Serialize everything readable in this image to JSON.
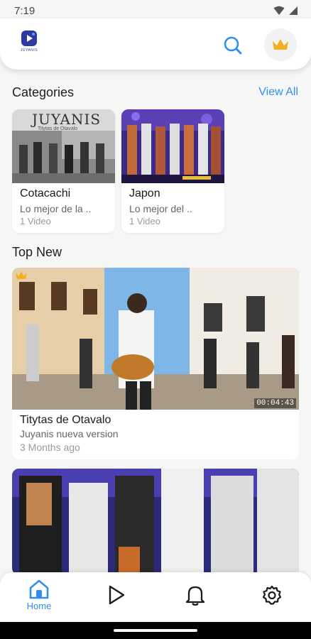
{
  "status_bar": {
    "time": "7:19"
  },
  "header": {
    "logo_text": "JUYANIS"
  },
  "categories": {
    "title": "Categories",
    "view_all_label": "View All",
    "items": [
      {
        "name": "Cotacachi",
        "description": "Lo mejor de la ..",
        "count": "1 Video",
        "thumb_caption_title": "JUYANIS",
        "thumb_caption_sub": "Titytas de Otavalo"
      },
      {
        "name": "Japon",
        "description": "Lo mejor del ..",
        "count": "1 Video"
      }
    ]
  },
  "top_new": {
    "title": "Top New",
    "videos": [
      {
        "title": "Titytas de Otavalo",
        "subtitle": "Juyanis nueva version",
        "time_ago": "3 Months ago",
        "duration": "00:04:43"
      }
    ]
  },
  "bottom_nav": {
    "items": [
      {
        "label": "Home",
        "icon": "home-icon",
        "active": true
      },
      {
        "label": "",
        "icon": "play-icon",
        "active": false
      },
      {
        "label": "",
        "icon": "bell-icon",
        "active": false
      },
      {
        "label": "",
        "icon": "gear-icon",
        "active": false
      }
    ]
  },
  "colors": {
    "accent": "#2f8ff0",
    "premium": "#f2b01e",
    "logo": "#2e3a9f"
  }
}
